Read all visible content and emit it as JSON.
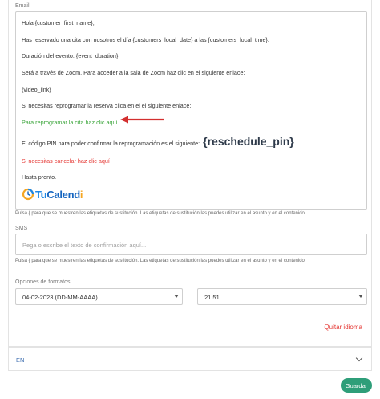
{
  "email": {
    "label": "Email",
    "lines": {
      "greeting": "Hola {customer_first_name},",
      "booked": "Has reservado una cita con nosotros el día {customers_local_date} a las {customers_local_time}.",
      "duration": "Duración del evento: {event_duration}",
      "zoom": "Será a través de Zoom. Para acceder a la sala de Zoom  haz clic en el siguiente enlace:",
      "video_link": "{video_link}",
      "reschedule_intro": "Si necesitas reprogramar la reserva  clica en el el siguiente enlace:",
      "reschedule_link": "Para reprogramar la cita haz clic aquí",
      "pin_text": "El código PIN para poder confirmar la reprogramación es el siguiente:",
      "pin_tag": "{reschedule_pin}",
      "cancel_link": "Si necesitas cancelar haz clic aquí",
      "farewell": "Hasta pronto."
    },
    "logo": {
      "tu": "Tu",
      "cal": "Calend",
      "i": "i"
    },
    "hint": "Pulsa { para que se muestren las etiquetas de sustitución. Las etiquetas de sustitución las puedes utilizar en el asunto y en el contenido."
  },
  "sms": {
    "label": "SMS",
    "placeholder": "Pega o escribe el texto de confirmación aquí...",
    "hint": "Pulsa { para que se muestren las etiquetas de sustitución. Las etiquetas de sustitución las puedes utilizar en el asunto y en el contenido."
  },
  "format_options": {
    "label": "Opciones de formatos",
    "date_format": "04-02-2023 (DD-MM-AAAA)",
    "time_format": "21:51"
  },
  "remove_language": "Quitar idioma",
  "language_row": {
    "label": "EN"
  },
  "save_button": "Guardar",
  "colors": {
    "green_link": "#3aa53a",
    "red_link": "#e53935",
    "arrow": "#d32f2f",
    "save_bg": "#2e9e79",
    "lang_label": "#3f6fb0"
  },
  "icons": {
    "arrow": "red-arrow-left-icon",
    "logo_mark": "tucalendi-clock-icon",
    "select_caret": "caret-down-icon",
    "chevron": "chevron-down-icon"
  }
}
